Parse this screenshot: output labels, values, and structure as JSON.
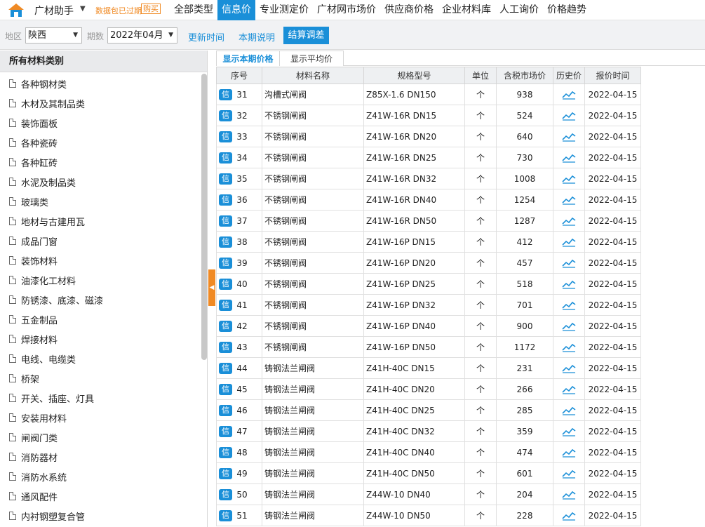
{
  "app": {
    "title": "广材助手",
    "expired_text": "数据包已过期",
    "buy_label": "购买"
  },
  "nav": {
    "tabs": [
      {
        "label": "全部类型",
        "active": false
      },
      {
        "label": "信息价",
        "active": true
      },
      {
        "label": "专业测定价",
        "active": false
      },
      {
        "label": "广材网市场价",
        "active": false
      },
      {
        "label": "供应商价格",
        "active": false
      },
      {
        "label": "企业材料库",
        "active": false
      },
      {
        "label": "人工询价",
        "active": false
      },
      {
        "label": "价格趋势",
        "active": false
      }
    ]
  },
  "toolbar": {
    "region_label": "地区",
    "region_value": "陕西",
    "period_label": "期数",
    "period_value": "2022年04月",
    "update_time_label": "更新时间",
    "period_note_label": "本期说明",
    "calc_adjust_label": "结算调差"
  },
  "sidebar": {
    "header": "所有材料类别",
    "items": [
      "各种钢材类",
      "木材及其制品类",
      "装饰面板",
      "各种瓷砖",
      "各种缸砖",
      "水泥及制品类",
      "玻璃类",
      "地材与古建用瓦",
      "成品门窗",
      "装饰材料",
      "油漆化工材料",
      "防锈漆、底漆、磁漆",
      "五金制品",
      "焊接材料",
      "电线、电缆类",
      "桥架",
      "开关、插座、灯具",
      "安装用材料",
      "闸阀门类",
      "消防器材",
      "消防水系统",
      "通风配件",
      "内衬钢塑复合管"
    ]
  },
  "subtabs": {
    "current": "显示本期价格",
    "average": "显示平均价"
  },
  "table": {
    "headers": [
      "序号",
      "材料名称",
      "规格型号",
      "单位",
      "含税市场价",
      "历史价",
      "报价时间"
    ],
    "badge": "信",
    "rows": [
      {
        "seq": "31",
        "name": "沟槽式闸阀",
        "spec": "Z85X-1.6 DN150",
        "unit": "个",
        "price": "938",
        "date": "2022-04-15"
      },
      {
        "seq": "32",
        "name": "不锈钢闸阀",
        "spec": "Z41W-16R DN15",
        "unit": "个",
        "price": "524",
        "date": "2022-04-15"
      },
      {
        "seq": "33",
        "name": "不锈钢闸阀",
        "spec": "Z41W-16R DN20",
        "unit": "个",
        "price": "640",
        "date": "2022-04-15"
      },
      {
        "seq": "34",
        "name": "不锈钢闸阀",
        "spec": "Z41W-16R DN25",
        "unit": "个",
        "price": "730",
        "date": "2022-04-15"
      },
      {
        "seq": "35",
        "name": "不锈钢闸阀",
        "spec": "Z41W-16R DN32",
        "unit": "个",
        "price": "1008",
        "date": "2022-04-15"
      },
      {
        "seq": "36",
        "name": "不锈钢闸阀",
        "spec": "Z41W-16R DN40",
        "unit": "个",
        "price": "1254",
        "date": "2022-04-15"
      },
      {
        "seq": "37",
        "name": "不锈钢闸阀",
        "spec": "Z41W-16R DN50",
        "unit": "个",
        "price": "1287",
        "date": "2022-04-15"
      },
      {
        "seq": "38",
        "name": "不锈钢闸阀",
        "spec": "Z41W-16P DN15",
        "unit": "个",
        "price": "412",
        "date": "2022-04-15"
      },
      {
        "seq": "39",
        "name": "不锈钢闸阀",
        "spec": "Z41W-16P DN20",
        "unit": "个",
        "price": "457",
        "date": "2022-04-15"
      },
      {
        "seq": "40",
        "name": "不锈钢闸阀",
        "spec": "Z41W-16P DN25",
        "unit": "个",
        "price": "518",
        "date": "2022-04-15"
      },
      {
        "seq": "41",
        "name": "不锈钢闸阀",
        "spec": "Z41W-16P DN32",
        "unit": "个",
        "price": "701",
        "date": "2022-04-15"
      },
      {
        "seq": "42",
        "name": "不锈钢闸阀",
        "spec": "Z41W-16P DN40",
        "unit": "个",
        "price": "900",
        "date": "2022-04-15"
      },
      {
        "seq": "43",
        "name": "不锈钢闸阀",
        "spec": "Z41W-16P DN50",
        "unit": "个",
        "price": "1172",
        "date": "2022-04-15"
      },
      {
        "seq": "44",
        "name": "铸钢法兰闸阀",
        "spec": "Z41H-40C DN15",
        "unit": "个",
        "price": "231",
        "date": "2022-04-15"
      },
      {
        "seq": "45",
        "name": "铸钢法兰闸阀",
        "spec": "Z41H-40C DN20",
        "unit": "个",
        "price": "266",
        "date": "2022-04-15"
      },
      {
        "seq": "46",
        "name": "铸钢法兰闸阀",
        "spec": "Z41H-40C DN25",
        "unit": "个",
        "price": "285",
        "date": "2022-04-15"
      },
      {
        "seq": "47",
        "name": "铸钢法兰闸阀",
        "spec": "Z41H-40C DN32",
        "unit": "个",
        "price": "359",
        "date": "2022-04-15"
      },
      {
        "seq": "48",
        "name": "铸钢法兰闸阀",
        "spec": "Z41H-40C DN40",
        "unit": "个",
        "price": "474",
        "date": "2022-04-15"
      },
      {
        "seq": "49",
        "name": "铸钢法兰闸阀",
        "spec": "Z41H-40C DN50",
        "unit": "个",
        "price": "601",
        "date": "2022-04-15"
      },
      {
        "seq": "50",
        "name": "铸钢法兰闸阀",
        "spec": "Z44W-10 DN40",
        "unit": "个",
        "price": "204",
        "date": "2022-04-15"
      },
      {
        "seq": "51",
        "name": "铸钢法兰闸阀",
        "spec": "Z44W-10 DN50",
        "unit": "个",
        "price": "228",
        "date": "2022-04-15"
      }
    ]
  },
  "colors": {
    "accent": "#1a8fd8",
    "warning": "#f08a24"
  },
  "icons": {
    "logo": "app-logo",
    "history": "trend-chart-icon",
    "doc": "document-icon"
  }
}
